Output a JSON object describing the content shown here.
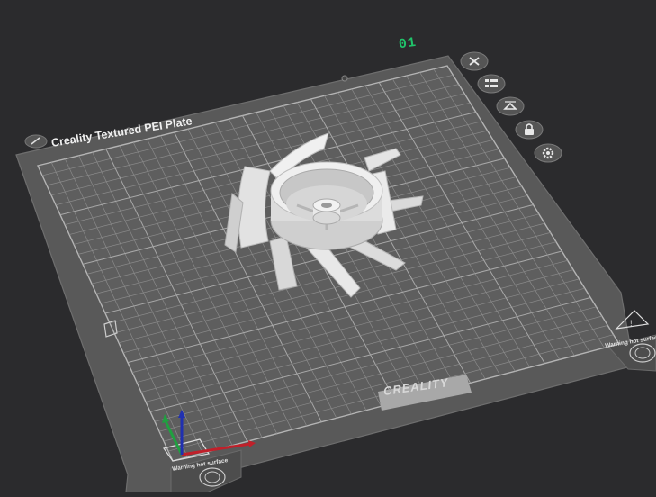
{
  "viewport": {
    "plate_number": "01",
    "plate_name": "Creality Textured PEI Plate",
    "brand_logo": "CREALITY",
    "warning_left": "Warning hot surface",
    "warning_right": "Warning hot surface"
  },
  "plate_tools": [
    {
      "name": "close-plate-button",
      "icon": "close-icon"
    },
    {
      "name": "arrange-objects-button",
      "icon": "arrange-icon"
    },
    {
      "name": "auto-orient-button",
      "icon": "orient-icon"
    },
    {
      "name": "lock-plate-button",
      "icon": "lock-icon"
    },
    {
      "name": "plate-settings-button",
      "icon": "gear-icon"
    }
  ],
  "colors": {
    "background": "#2b2b2d",
    "plate": "#616161",
    "plate_edge": "#4a4a4a",
    "grid": "#8c8c8c",
    "model": "#e6e6e6",
    "plate_number": "#20c36a",
    "axis_x": "#c0202a",
    "axis_y": "#20a040",
    "axis_z": "#2030b0"
  }
}
